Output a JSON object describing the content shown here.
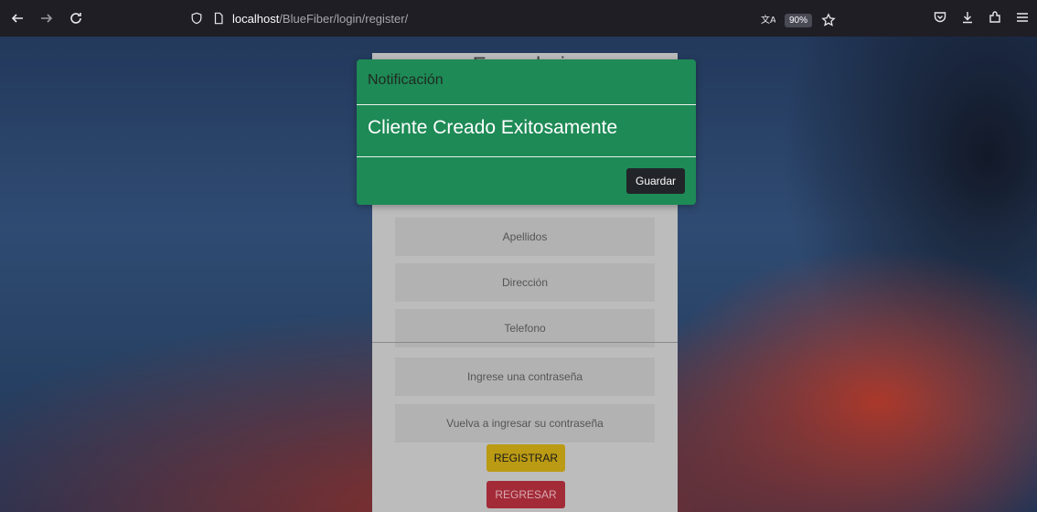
{
  "browser": {
    "url_host": "localhost",
    "url_path": "/BlueFiber/login/register/",
    "zoom": "90%",
    "icons": {
      "back": "arrow-left-icon",
      "forward": "arrow-right-icon",
      "reload": "reload-icon",
      "shield": "tracking-shield-icon",
      "page": "page-icon",
      "translate": "translate-icon",
      "bookmark": "star-icon",
      "pocket": "pocket-icon",
      "downloads": "download-icon",
      "extensions": "extensions-icon",
      "menu": "hamburger-menu-icon"
    }
  },
  "form": {
    "title": "Formulario",
    "fields": {
      "apellidos": "Apellidos",
      "direccion": "Dirección",
      "telefono": "Telefono",
      "password": "Ingrese una contraseña",
      "password_confirm": "Vuelva a ingresar su contraseña"
    },
    "register_label": "REGISTRAR",
    "back_label": "REGRESAR"
  },
  "modal": {
    "title": "Notificación",
    "message": "Cliente Creado Exitosamente",
    "button_label": "Guardar",
    "color": "#1e8a56"
  }
}
